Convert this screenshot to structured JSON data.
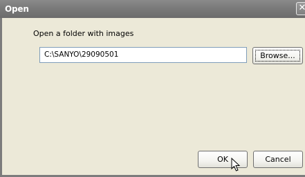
{
  "window": {
    "title": "Open",
    "close_glyph": "✕"
  },
  "dialog": {
    "prompt": "Open a folder with images",
    "path_value": "C:\\SANYO\\29090501",
    "browse_label": "Browse...",
    "ok_label": "OK",
    "cancel_label": "Cancel"
  },
  "icons": {
    "close": "close-icon",
    "cursor": "mouse-pointer-icon"
  }
}
